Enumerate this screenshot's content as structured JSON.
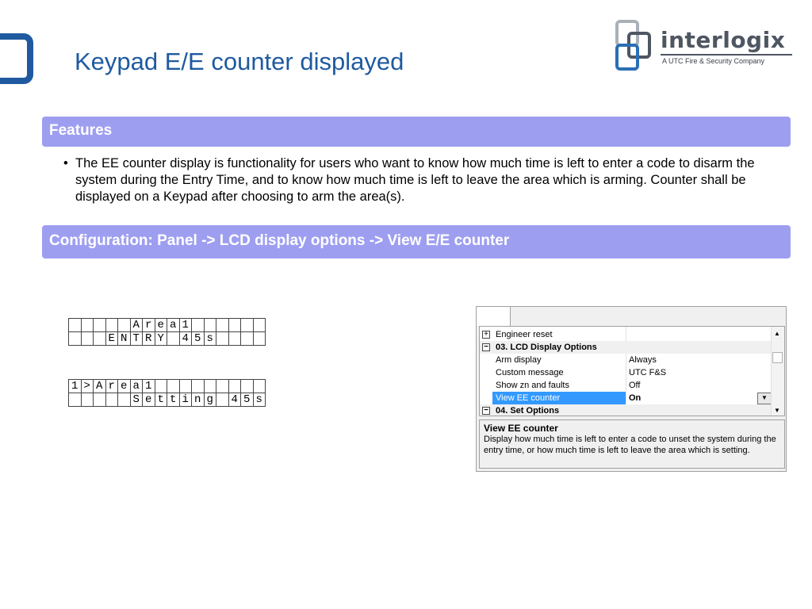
{
  "slide": {
    "title": "Keypad E/E counter displayed"
  },
  "logo": {
    "name": "interlogix",
    "tagline": "A UTC Fire & Security Company"
  },
  "features": {
    "header": "Features",
    "bullet": "The EE counter display is functionality for users who want to know how much time is left to enter a code to disarm the system during the Entry Time, and to know how much time is left to leave the area which is arming. Counter shall be displayed on a Keypad after choosing to arm the area(s)."
  },
  "configuration": {
    "header": "Configuration: Panel -> LCD display options -> View E/E counter"
  },
  "lcd_displays": [
    {
      "rows": [
        [
          "",
          "",
          "",
          "",
          "",
          "A",
          "r",
          "e",
          "a",
          "1",
          "",
          "",
          "",
          "",
          "",
          ""
        ],
        [
          "",
          "",
          "",
          "E",
          "N",
          "T",
          "R",
          "Y",
          "",
          "4",
          "5",
          "s",
          "",
          "",
          "",
          ""
        ]
      ]
    },
    {
      "rows": [
        [
          "1",
          ">",
          "A",
          "r",
          "e",
          "a",
          "1",
          "",
          "",
          "",
          "",
          "",
          "",
          "",
          "",
          ""
        ],
        [
          "",
          "",
          "",
          "",
          "",
          "S",
          "e",
          "t",
          "t",
          "i",
          "n",
          "g",
          "",
          "4",
          "5",
          "s"
        ]
      ]
    }
  ],
  "property_grid": {
    "rows": [
      {
        "expander": "+",
        "name": "Engineer reset",
        "value": "",
        "type": "item-collapsed"
      },
      {
        "expander": "−",
        "name": "03. LCD Display Options",
        "value": "",
        "type": "category"
      },
      {
        "name": "Arm display",
        "value": "Always",
        "type": "item"
      },
      {
        "name": "Custom message",
        "value": "UTC F&S",
        "type": "item"
      },
      {
        "name": "Show zn and faults",
        "value": "Off",
        "type": "item"
      },
      {
        "name": "View EE counter",
        "value": "On",
        "type": "selected"
      },
      {
        "expander": "−",
        "name": "04. Set Options",
        "value": "",
        "type": "category"
      }
    ],
    "help": {
      "title": "View EE counter",
      "text": "Display how much time is left to enter a code to unset the system during the entry time, or how much time is left to leave the area which is setting."
    }
  },
  "icons": {
    "corner": "rounded-square-frame-icon",
    "logo_mark": "interlocking-squares-logo-icon",
    "expand": "plus-box-icon",
    "collapse": "minus-box-icon",
    "dropdown": "chevron-down-icon",
    "scroll_up": "arrow-up-icon",
    "scroll_down": "arrow-down-icon"
  },
  "colors": {
    "title": "#1f5aa0",
    "banner_bg": "#9e9ef1",
    "banner_text": "#ffffff",
    "selection": "#3399ff"
  }
}
